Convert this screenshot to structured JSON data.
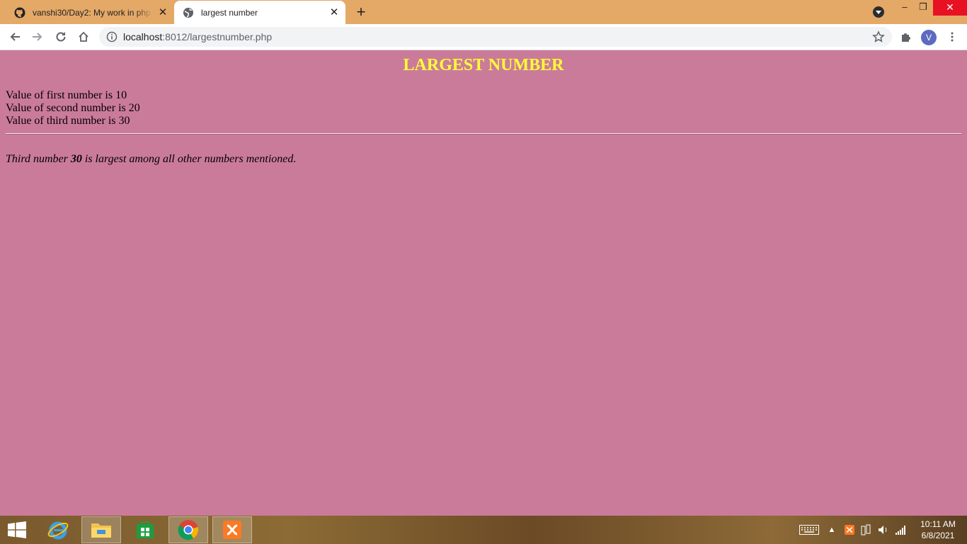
{
  "browser": {
    "tabs": [
      {
        "title": "vanshi30/Day2: My work in php c",
        "icon": "github-icon",
        "active": false
      },
      {
        "title": "largest number",
        "icon": "globe-icon",
        "active": true
      }
    ],
    "new_tab_label": "+",
    "url_host": "localhost",
    "url_path": ":8012/largestnumber.php",
    "profile_initial": "V"
  },
  "page": {
    "heading": "LARGEST NUMBER",
    "lines": [
      "Value of first number is 10",
      "Value of second number is 20",
      "Value of third number is 30"
    ],
    "result_prefix": "Third number ",
    "result_value": "30",
    "result_suffix": " is largest among all other numbers mentioned."
  },
  "colors": {
    "page_background": "#cb7b9a",
    "heading_color": "#ffff33",
    "tabstrip": "#e4a867"
  },
  "taskbar": {
    "apps": [
      "internet-explorer-icon",
      "file-explorer-icon",
      "store-icon",
      "chrome-icon",
      "xampp-icon"
    ],
    "time": "10:11 AM",
    "date": "6/8/2021"
  }
}
